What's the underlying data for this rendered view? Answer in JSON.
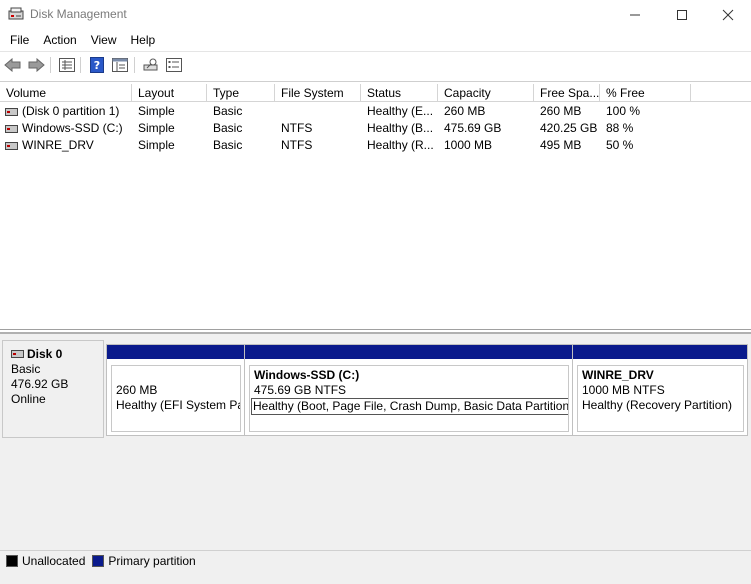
{
  "window": {
    "title": "Disk Management",
    "controls": {
      "minimize": "—",
      "maximize": "☐",
      "close": "✕"
    }
  },
  "menu": [
    "File",
    "Action",
    "View",
    "Help"
  ],
  "toolbar": {
    "buttons": [
      "back-arrow-icon",
      "forward-arrow-icon",
      "properties-list-icon",
      "help-icon",
      "console-tree-icon",
      "connect-disk-icon",
      "settings-list-icon"
    ]
  },
  "volume_table": {
    "columns": [
      "Volume",
      "Layout",
      "Type",
      "File System",
      "Status",
      "Capacity",
      "Free Spa...",
      "% Free"
    ],
    "rows": [
      [
        "(Disk 0 partition 1)",
        "Simple",
        "Basic",
        "",
        "Healthy (E...",
        "260 MB",
        "260 MB",
        "100 %"
      ],
      [
        "Windows-SSD (C:)",
        "Simple",
        "Basic",
        "NTFS",
        "Healthy (B...",
        "475.69 GB",
        "420.25 GB",
        "88 %"
      ],
      [
        "WINRE_DRV",
        "Simple",
        "Basic",
        "NTFS",
        "Healthy (R...",
        "1000 MB",
        "495 MB",
        "50 %"
      ]
    ]
  },
  "disk": {
    "name": "Disk 0",
    "type": "Basic",
    "size": "476.92 GB",
    "state": "Online",
    "partitions": [
      {
        "name": "",
        "size": "260 MB",
        "status": "Healthy (EFI System Par"
      },
      {
        "name": "Windows-SSD  (C:)",
        "size": "475.69 GB NTFS",
        "status": "Healthy (Boot, Page File, Crash Dump, Basic Data Partition)"
      },
      {
        "name": "WINRE_DRV",
        "size": "1000 MB NTFS",
        "status": "Healthy (Recovery Partition)"
      }
    ]
  },
  "legend": {
    "items": [
      {
        "label": "Unallocated",
        "color": "#000000"
      },
      {
        "label": "Primary partition",
        "color": "#0a1a8c"
      }
    ]
  },
  "colors": {
    "primary_partition": "#0a1a8c",
    "unallocated": "#000000"
  }
}
